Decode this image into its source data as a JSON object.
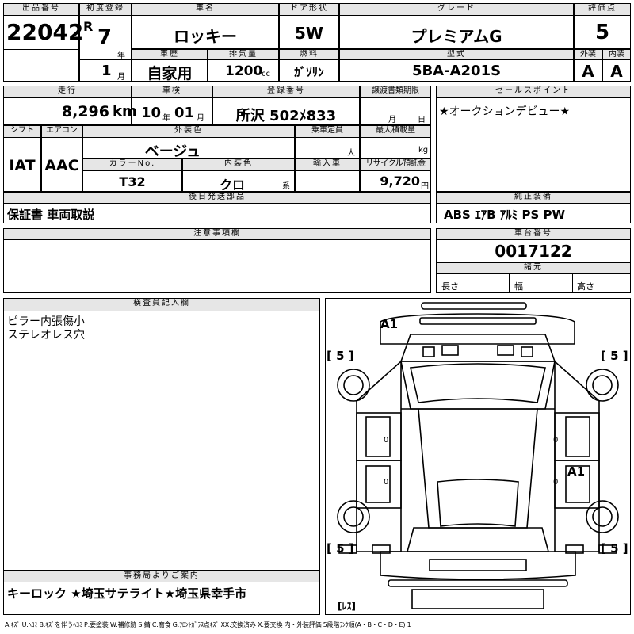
{
  "header": {
    "lot_label": "出品番号",
    "lot_number": "22042",
    "first_reg_label": "初度登録",
    "era_mark": "R",
    "reg_year": "7",
    "year_unit": "年",
    "reg_month": "1",
    "month_unit": "月",
    "car_name_label": "車名",
    "car_name": "ロッキー",
    "door_label": "ドア形状",
    "door_type": "5W",
    "grade_label": "グレード",
    "grade": "プレミアムG",
    "score_label": "評価点",
    "score": "5",
    "history_label": "車歴",
    "history": "自家用",
    "displacement_label": "排気量",
    "displacement": "1200",
    "cc_unit": "cc",
    "fuel_label": "燃料",
    "fuel": "ｶﾞｿﾘﾝ",
    "model_label": "型式",
    "model_code": "5BA-A201S",
    "exterior_label": "外装",
    "exterior_grade": "A",
    "interior_label": "内装",
    "interior_grade": "A"
  },
  "row2": {
    "mileage_label": "走行",
    "mileage": "8,296",
    "km_unit": "km",
    "inspection_label": "車検",
    "insp_year": "10",
    "insp_year_unit": "年",
    "insp_month": "01",
    "insp_month_unit": "月",
    "plate_label": "登録番号",
    "plate": "所沢 502ﾒ833",
    "transfer_label": "譲渡書類期限",
    "transfer_month_unit": "月",
    "transfer_day_unit": "日",
    "sales_point_label": "セールスポイント",
    "sales_point": "★オークションデビュー★",
    "shift_label": "シフト",
    "shift": "IAT",
    "ac_label": "エアコン",
    "ac": "AAC",
    "ext_color_label": "外装色",
    "ext_color": "ベージュ",
    "capacity_label": "乗車定員",
    "capacity_unit": "人",
    "max_load_label": "最大積載量",
    "max_load_unit": "kg",
    "color_no_label": "カラーNo.",
    "color_no": "T32",
    "int_color_label": "内装色",
    "int_color": "クロ",
    "int_color_unit": "系",
    "import_label": "輸入車",
    "recycle_label": "リサイクル預託金",
    "recycle": "9,720",
    "recycle_unit": "円"
  },
  "later_parts": {
    "label": "後日発送部品",
    "value": "保証書 車両取説"
  },
  "equipment": {
    "label": "純正装備",
    "value": "ABS ｴｱB ｱﾙﾐ PS PW"
  },
  "notes": {
    "label": "注意事項欄"
  },
  "chassis": {
    "label": "車台番号",
    "value": "0017122",
    "specs_label": "諸元",
    "length_label": "長さ",
    "width_label": "幅",
    "height_label": "高さ"
  },
  "inspector": {
    "label": "検査員記入欄",
    "line1": "ピラー内張傷小",
    "line2": "ステレオレス穴"
  },
  "office": {
    "label": "事務局よりご案内",
    "value": "キーロック ★埼玉サテライト★埼玉県幸手市"
  },
  "diagram": {
    "tire_fl": "[ 5 ]",
    "tire_fr": "[ 5 ]",
    "tire_rl": "[ 5 ]",
    "tire_rr": "[ 5 ]",
    "mark_front": "A1",
    "mark_right": "A1",
    "spare": "[ﾚｽ]",
    "handle_mark": "0"
  },
  "legend": "A:ｷｽﾞ U:ﾍｺﾐ B:ｷｽﾞを伴うﾍｺﾐ P:要塗装 W:補修跡 S:錆 C:腐食 G:ﾌﾛﾝﾄｶﾞﾗｽ点ｷｽﾞ XX:交換済み X:要交換 内・外装評価 5段階ﾗﾝｸ順(A・B・C・D・E) 1"
}
